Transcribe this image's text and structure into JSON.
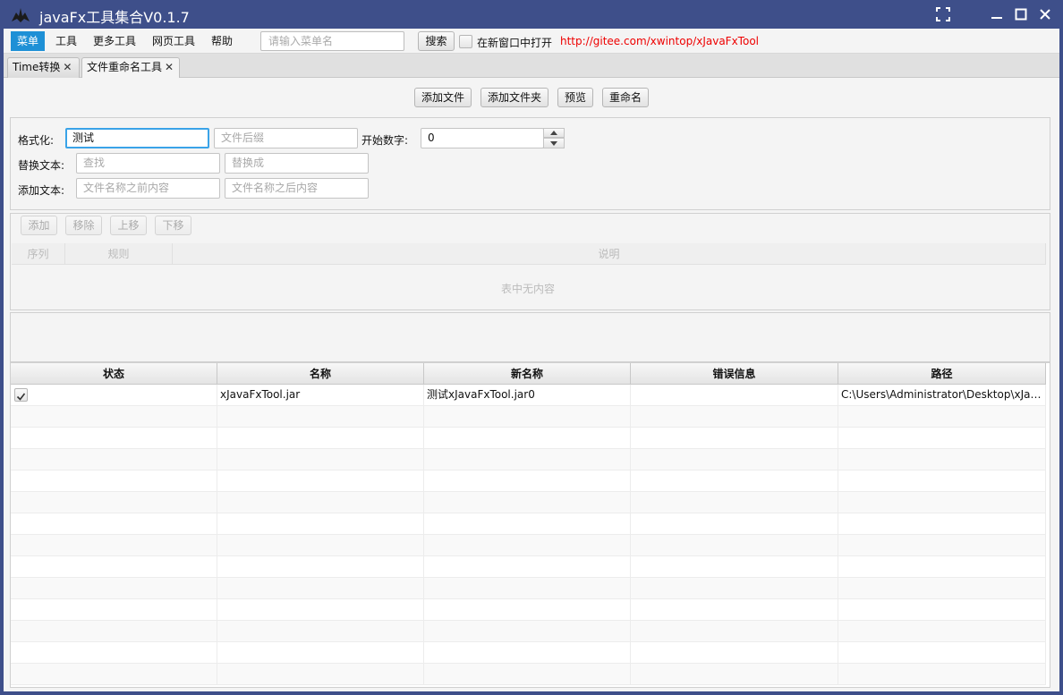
{
  "window": {
    "title": "javaFx工具集合V0.1.7"
  },
  "menubar": {
    "items": [
      "菜单",
      "工具",
      "更多工具",
      "网页工具",
      "帮助"
    ],
    "search_placeholder": "请输入菜单名",
    "search_button": "搜索",
    "new_window_label": "在新窗口中打开",
    "link": "http://gitee.com/xwintop/xJavaFxTool"
  },
  "tabs": [
    {
      "label": "Time转换"
    },
    {
      "label": "文件重命名工具"
    }
  ],
  "toolbar": {
    "add_file": "添加文件",
    "add_folder": "添加文件夹",
    "preview": "预览",
    "rename": "重命名"
  },
  "form": {
    "format_label": "格式化:",
    "format_value": "测试",
    "suffix_placeholder": "文件后缀",
    "start_number_label": "开始数字:",
    "start_number_value": "0",
    "replace_label": "替换文本:",
    "find_placeholder": "查找",
    "replace_placeholder": "替换成",
    "add_label": "添加文本:",
    "prefix_placeholder": "文件名称之前内容",
    "postfix_placeholder": "文件名称之后内容"
  },
  "rules": {
    "buttons": [
      "添加",
      "移除",
      "上移",
      "下移"
    ],
    "columns": [
      "序列",
      "规则",
      "说明"
    ],
    "empty_text": "表中无内容"
  },
  "files": {
    "columns": [
      "状态",
      "名称",
      "新名称",
      "错误信息",
      "路径"
    ],
    "rows": [
      {
        "checked": true,
        "name": "xJavaFxTool.jar",
        "new_name": "测试xJavaFxTool.jar0",
        "error": "",
        "path": "C:\\Users\\Administrator\\Desktop\\xJavaFxTool.jar"
      }
    ]
  },
  "colors": {
    "titlebar": "#3e4f8a",
    "menu_active": "#1e90d6",
    "link": "#ee0000",
    "focus": "#3aa3e8"
  }
}
